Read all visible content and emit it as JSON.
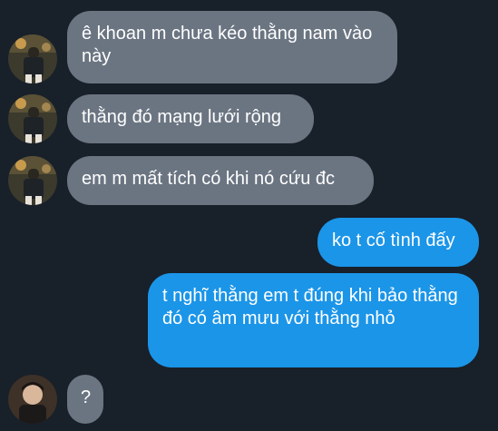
{
  "conversation": {
    "messages": [
      {
        "direction": "incoming",
        "text": "ê khoan m chưa kéo thằng nam vào này"
      },
      {
        "direction": "incoming",
        "text": "thằng đó mạng lưới rộng"
      },
      {
        "direction": "incoming",
        "text": "em m mất tích có khi nó cứu đc"
      },
      {
        "direction": "outgoing",
        "text": "ko t cố tình đấy"
      },
      {
        "direction": "outgoing",
        "text": "t nghĩ thằng em t đúng khi bảo thằng đó có âm mưu với thằng nhỏ"
      },
      {
        "direction": "incoming",
        "text": "?"
      }
    ]
  },
  "colors": {
    "background": "#18202a",
    "incoming_bubble": "#6b7582",
    "outgoing_bubble": "#1b95e8",
    "text": "#ffffff"
  },
  "icons": {
    "avatar_a": "person-photo-avatar",
    "avatar_b": "person-photo-avatar"
  }
}
